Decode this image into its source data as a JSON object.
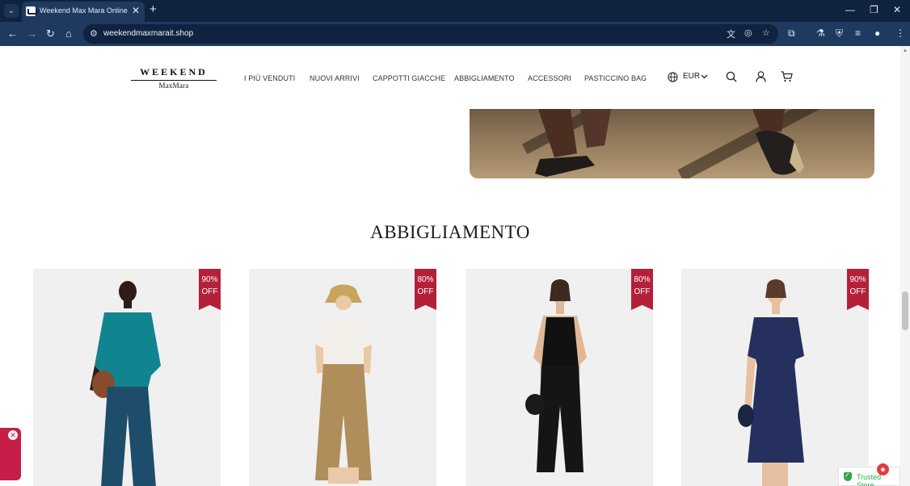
{
  "browser": {
    "tab_title": "Weekend Max Mara Online Sto",
    "url": "weekendmaxmarait.shop",
    "icons": {
      "tab_menu": "chevron-down-icon",
      "tab_close": "close-icon",
      "new_tab": "plus-icon",
      "back": "back-arrow-icon",
      "forward": "forward-arrow-icon",
      "reload": "reload-icon",
      "home": "home-icon",
      "site_info": "tune-icon",
      "translate": "translate-icon",
      "eye_off": "eye-off-icon",
      "bookmark": "star-icon",
      "extensions": "puzzle-icon",
      "labs": "flask-icon",
      "shield": "shield-icon",
      "media": "media-queue-icon",
      "profile": "profile-icon",
      "menu": "kebab-menu-icon"
    }
  },
  "header": {
    "logo_top": "WEEKEND",
    "logo_bottom": "MaxMara",
    "nav": [
      {
        "label": "I PIÙ VENDUTI"
      },
      {
        "label": "NUOVI ARRIVI"
      },
      {
        "label": "CAPPOTTI GIACCHE"
      },
      {
        "label": "ABBIGLIAMENTO"
      },
      {
        "label": "ACCESSORI"
      },
      {
        "label": "PASTICCINO BAG"
      }
    ],
    "currency": "EUR",
    "icons": {
      "globe": "globe-icon",
      "search": "search-icon",
      "account": "user-icon",
      "cart": "cart-icon",
      "caret": "chevron-down-icon"
    }
  },
  "section": {
    "title": "ABBIGLIAMENTO"
  },
  "products": [
    {
      "discount_pct": "90%",
      "off": "OFF",
      "top_color": "#10858f",
      "bottom_color": "#1e4d6b"
    },
    {
      "discount_pct": "80%",
      "off": "OFF",
      "top_color": "#f2efe8",
      "bottom_color": "#b08e5b"
    },
    {
      "discount_pct": "80%",
      "off": "OFF",
      "top_color": "#111111",
      "bottom_color": "#151515"
    },
    {
      "discount_pct": "90%",
      "off": "OFF",
      "top_color": "#25305e",
      "bottom_color": "#25305e"
    }
  ],
  "widgets": {
    "trusted_text": "Trusted Store",
    "badge_icon": "notification-badge-icon"
  },
  "colors": {
    "chrome_dark": "#0f2340",
    "chrome_toolbar": "#1f3a5e",
    "ribbon": "#b4203a",
    "widget": "#c51e48",
    "trusted_green": "#2fa84f"
  }
}
